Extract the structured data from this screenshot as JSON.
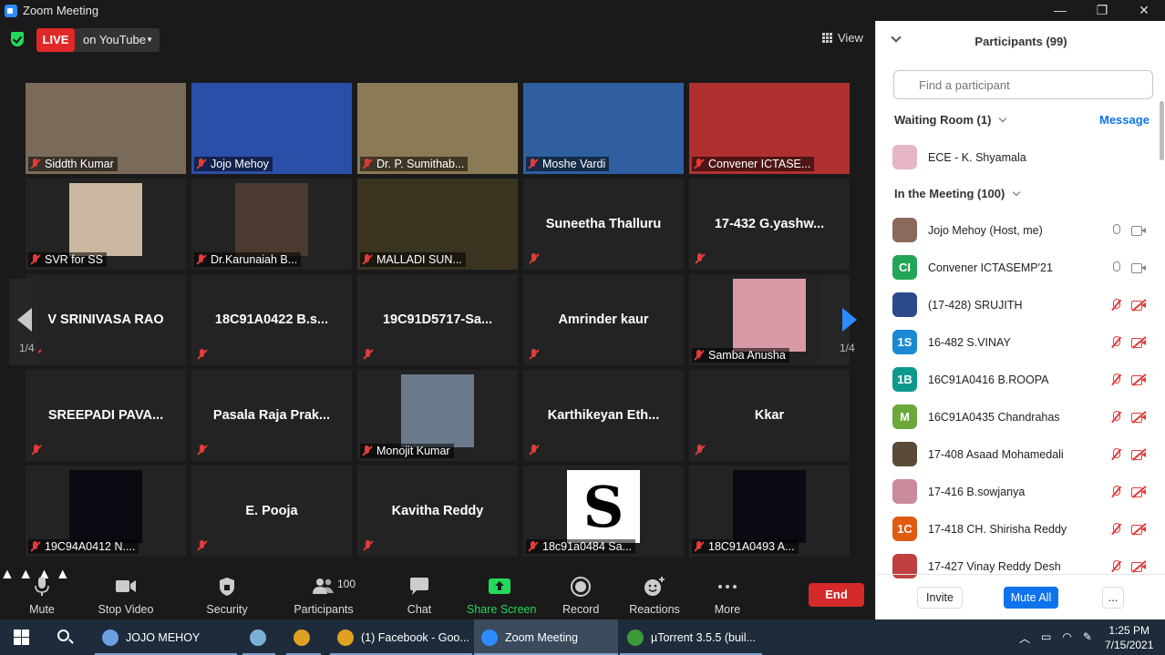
{
  "window": {
    "title": "Zoom Meeting",
    "controls": [
      "—",
      "❐",
      "✕"
    ]
  },
  "meeting": {
    "live_label": "LIVE",
    "live_platform": "on YouTube",
    "view_label": "View",
    "page_left": "1/4",
    "page_right": "1/4"
  },
  "tiles": [
    {
      "name": "Siddth Kumar",
      "style": "label",
      "photo_color": "#7a6a5a"
    },
    {
      "name": "Jojo Mehoy",
      "style": "label",
      "active": true,
      "photo_color": "#2a4fa8"
    },
    {
      "name": "Dr. P. Sumithab...",
      "style": "label",
      "photo_color": "#8a7a55"
    },
    {
      "name": "Moshe Vardi",
      "style": "label",
      "photo_color": "#2f5fa0"
    },
    {
      "name": "Convener ICTASE...",
      "style": "label",
      "photo_color": "#b03030"
    },
    {
      "name": "SVR for SS",
      "style": "label",
      "photo_color": "#ccb8a0"
    },
    {
      "name": "Dr.Karunaiah B...",
      "style": "label",
      "photo_color": "#4a3a30"
    },
    {
      "name": "MALLADI SUN...",
      "style": "label",
      "photo_color": "#3a3320"
    },
    {
      "name": "Suneetha Thalluru",
      "style": "center"
    },
    {
      "name": "17-432 G.yashw...",
      "style": "center"
    },
    {
      "name": "V SRINIVASA RAO",
      "style": "center"
    },
    {
      "name": "18C91A0422 B.s...",
      "style": "center"
    },
    {
      "name": "19C91D5717-Sa...",
      "style": "center"
    },
    {
      "name": "Amrinder kaur",
      "style": "center"
    },
    {
      "name": "Samba Anusha",
      "style": "label",
      "photo_color": "#d89aa5"
    },
    {
      "name": "SREEPADI  PAVA...",
      "style": "center"
    },
    {
      "name": "Pasala  Raja  Prak...",
      "style": "center"
    },
    {
      "name": "Monojit Kumar",
      "style": "label",
      "photo_color": "#6a7a8a"
    },
    {
      "name": "Karthikeyan  Eth...",
      "style": "center"
    },
    {
      "name": "Kkar",
      "style": "center"
    },
    {
      "name": "19C94A0412 N....",
      "style": "label",
      "photo_color": "#0a0a12"
    },
    {
      "name": "E. Pooja",
      "style": "center"
    },
    {
      "name": "Kavitha Reddy",
      "style": "center"
    },
    {
      "name": "18c91a0484 Sa...",
      "style": "label",
      "photo_color": "#ffffff",
      "photo_text": "S"
    },
    {
      "name": "18C91A0493 A...",
      "style": "label",
      "photo_color": "#0a0a12"
    }
  ],
  "toolbar": {
    "mute": "Mute",
    "stop_video": "Stop Video",
    "security": "Security",
    "participants": "Participants",
    "participants_count": "100",
    "chat": "Chat",
    "share_screen": "Share Screen",
    "record": "Record",
    "reactions": "Reactions",
    "more": "More",
    "end": "End"
  },
  "panel": {
    "title": "Participants (99)",
    "search_placeholder": "Find a participant",
    "waiting_room": "Waiting Room (1)",
    "message": "Message",
    "waiting": [
      {
        "name": "ECE - K. Shyamala",
        "avatar_color": "#e7b6c4"
      }
    ],
    "in_meeting": "In the Meeting (100)",
    "participants": [
      {
        "name": "Jojo Mehoy (Host, me)",
        "initials": "",
        "avatar_color": "#8a6a5a",
        "muted": false
      },
      {
        "name": "Convener ICTASEMP'21",
        "initials": "CI",
        "avatar_color": "#23a559",
        "muted": false
      },
      {
        "name": "(17-428) SRUJITH",
        "initials": "",
        "avatar_color": "#2a4a8a",
        "muted": true
      },
      {
        "name": "16-482 S.VINAY",
        "initials": "1S",
        "avatar_color": "#1a8ad4",
        "muted": true
      },
      {
        "name": "16C91A0416 B.ROOPA",
        "initials": "1B",
        "avatar_color": "#0e9a8a",
        "muted": true
      },
      {
        "name": "16C91A0435 Chandrahas",
        "initials": "M",
        "avatar_color": "#6aa83a",
        "muted": true
      },
      {
        "name": "17-408 Asaad Mohamedali",
        "initials": "",
        "avatar_color": "#5a4a3a",
        "muted": true
      },
      {
        "name": "17-416 B.sowjanya",
        "initials": "",
        "avatar_color": "#c98a9a",
        "muted": true
      },
      {
        "name": "17-418 CH. Shirisha Reddy",
        "initials": "1C",
        "avatar_color": "#e05a10",
        "muted": true
      },
      {
        "name": "17-427  Vinay Reddy Desh",
        "initials": "",
        "avatar_color": "#c04040",
        "muted": true
      }
    ],
    "invite": "Invite",
    "mute_all": "Mute All",
    "more": "..."
  },
  "taskbar": {
    "items": [
      {
        "label": "JOJO MEHOY",
        "icon_color": "#6aa0e0"
      },
      {
        "label": "",
        "icon_color": "#7ab0d8"
      },
      {
        "label": "",
        "icon_color": "#e0a020"
      },
      {
        "label": "(1) Facebook - Goo...",
        "icon_color": "#e0a020"
      },
      {
        "label": "Zoom Meeting",
        "icon_color": "#2d8cff"
      },
      {
        "label": "µTorrent 3.5.5  (buil...",
        "icon_color": "#3a9a3a"
      }
    ],
    "time": "1:25 PM",
    "date": "7/15/2021"
  }
}
